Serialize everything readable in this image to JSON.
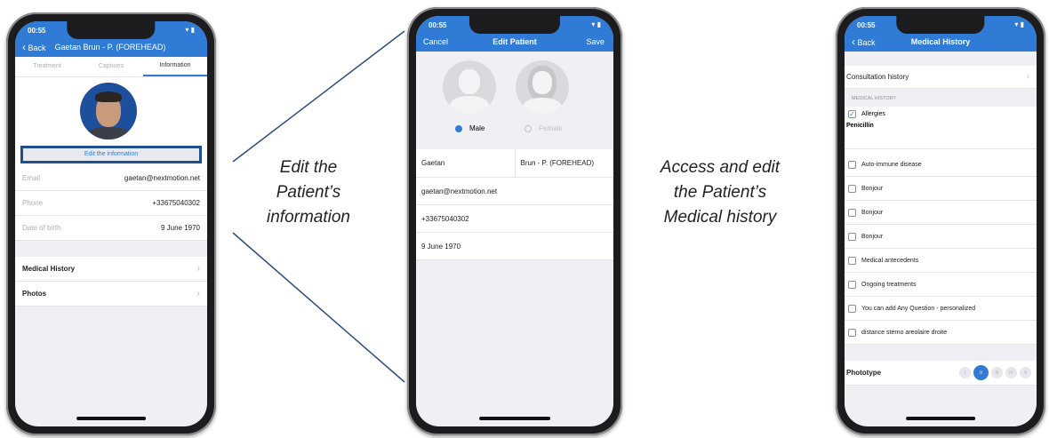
{
  "phone1": {
    "status_time": "00:55",
    "back_label": "Back",
    "title": "Gaetan Brun - P. (FOREHEAD)",
    "tabs": [
      "Treatment",
      "Captures",
      "Information"
    ],
    "edit_button": "Edit the information",
    "fields": [
      {
        "label": "Email",
        "value": "gaetan@nextmotion.net"
      },
      {
        "label": "Phone",
        "value": "+33675040302"
      },
      {
        "label": "Date of birth",
        "value": "9 June 1970"
      }
    ],
    "links": [
      "Medical History",
      "Photos"
    ]
  },
  "caption1": [
    "Edit the",
    "Patient’s",
    "information"
  ],
  "phone2": {
    "status_time": "00:55",
    "cancel_label": "Cancel",
    "title": "Edit Patient",
    "save_label": "Save",
    "gender_male": "Male",
    "gender_female": "Female",
    "first_name": "Gaetan",
    "last_name": "Brun - P. (FOREHEAD)",
    "email": "gaetan@nextmotion.net",
    "phone": "+33675040302",
    "dob": "9 June 1970"
  },
  "caption2": [
    "Access and edit",
    "the Patient’s",
    "Medical history"
  ],
  "phone3": {
    "status_time": "00:55",
    "back_label": "Back",
    "title": "Medical History",
    "consultation": "Consultation history",
    "section_header": "MEDICAL HISTORY",
    "allergies_label": "Allergies",
    "allergies_value": "Penicillin",
    "items": [
      "Auto-immune disease",
      "Bonjour",
      "Bonjour",
      "Bonjour",
      "Medical antecedents",
      "Ongoing treatments",
      "You can add Any Question - personalized",
      "distance sterno areolaire droite"
    ],
    "phototype_label": "Phototype",
    "phototypes": [
      "I",
      "II",
      "III",
      "IV",
      "V"
    ],
    "phototype_selected": "II"
  },
  "colors": {
    "accent": "#2f7bd6",
    "highlight_box": "#1e4f8c"
  }
}
